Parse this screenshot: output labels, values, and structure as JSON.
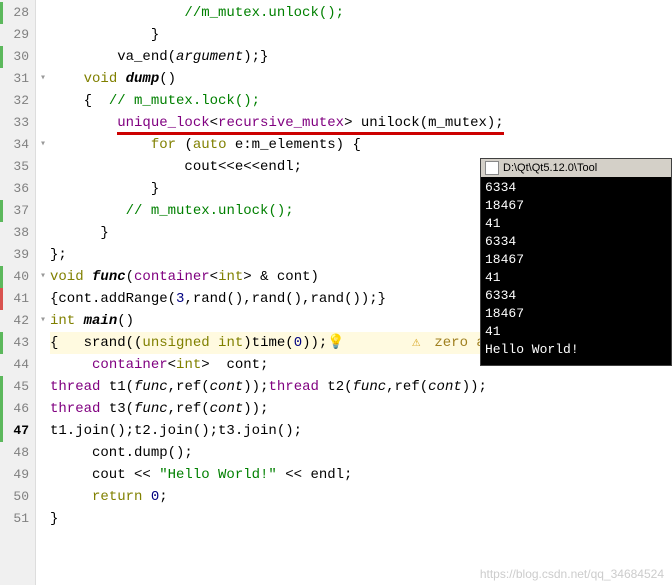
{
  "lines": [
    {
      "n": "28",
      "mark": "green",
      "fold": "",
      "code": "                //m_mutex.unlock();",
      "cls": [
        "comment"
      ]
    },
    {
      "n": "29",
      "mark": "",
      "fold": "",
      "code": "            }"
    },
    {
      "n": "30",
      "mark": "green",
      "fold": "",
      "code": "        va_end(argument);}",
      "parts": [
        {
          "t": "        va_end(",
          "c": ""
        },
        {
          "t": "argument",
          "c": "param"
        },
        {
          "t": ");}",
          "c": ""
        }
      ]
    },
    {
      "n": "31",
      "mark": "",
      "fold": "▾",
      "code": "    void dump()",
      "parts": [
        {
          "t": "    ",
          "c": ""
        },
        {
          "t": "void",
          "c": "kw"
        },
        {
          "t": " ",
          "c": ""
        },
        {
          "t": "dump",
          "c": "func"
        },
        {
          "t": "()",
          "c": ""
        }
      ]
    },
    {
      "n": "32",
      "mark": "",
      "fold": "",
      "code": "    {  // m_mutex.lock();",
      "parts": [
        {
          "t": "    {  ",
          "c": ""
        },
        {
          "t": "// m_mutex.lock();",
          "c": "comment"
        }
      ]
    },
    {
      "n": "33",
      "mark": "",
      "fold": "",
      "code": "        unique_lock<recursive_mutex> unilock(m_mutex);",
      "ul": true,
      "parts": [
        {
          "t": "        ",
          "c": ""
        },
        {
          "t": "unique_lock",
          "c": "type"
        },
        {
          "t": "<",
          "c": ""
        },
        {
          "t": "recursive_mutex",
          "c": "type"
        },
        {
          "t": "> unilock(m_mutex);",
          "c": ""
        }
      ]
    },
    {
      "n": "34",
      "mark": "",
      "fold": "▾",
      "code": "            for (auto e:m_elements) {",
      "parts": [
        {
          "t": "            ",
          "c": ""
        },
        {
          "t": "for",
          "c": "kw"
        },
        {
          "t": " (",
          "c": ""
        },
        {
          "t": "auto",
          "c": "kw"
        },
        {
          "t": " e:m_elements) {",
          "c": ""
        }
      ]
    },
    {
      "n": "35",
      "mark": "",
      "fold": "",
      "code": "                cout<<e<<endl;"
    },
    {
      "n": "36",
      "mark": "",
      "fold": "",
      "code": "            }"
    },
    {
      "n": "37",
      "mark": "green",
      "fold": "",
      "code": "         // m_mutex.unlock();",
      "parts": [
        {
          "t": "         ",
          "c": ""
        },
        {
          "t": "// m_mutex.unlock();",
          "c": "comment"
        }
      ]
    },
    {
      "n": "38",
      "mark": "",
      "fold": "",
      "code": "      }"
    },
    {
      "n": "39",
      "mark": "",
      "fold": "",
      "code": "};"
    },
    {
      "n": "40",
      "mark": "green",
      "fold": "▾",
      "code": "void func(container<int> & cont)",
      "parts": [
        {
          "t": "",
          "c": ""
        },
        {
          "t": "void",
          "c": "kw"
        },
        {
          "t": " ",
          "c": ""
        },
        {
          "t": "func",
          "c": "func"
        },
        {
          "t": "(",
          "c": ""
        },
        {
          "t": "container",
          "c": "type"
        },
        {
          "t": "<",
          "c": ""
        },
        {
          "t": "int",
          "c": "kw"
        },
        {
          "t": "> & cont)",
          "c": ""
        }
      ]
    },
    {
      "n": "41",
      "mark": "red",
      "fold": "",
      "code": "{cont.addRange(3,rand(),rand(),rand());}",
      "parts": [
        {
          "t": "{cont.addRange(",
          "c": ""
        },
        {
          "t": "3",
          "c": "num"
        },
        {
          "t": ",rand(),rand(),rand());}",
          "c": ""
        }
      ]
    },
    {
      "n": "42",
      "mark": "",
      "fold": "▾",
      "code": "int main()",
      "parts": [
        {
          "t": "",
          "c": ""
        },
        {
          "t": "int",
          "c": "kw"
        },
        {
          "t": " ",
          "c": ""
        },
        {
          "t": "main",
          "c": "func"
        },
        {
          "t": "()",
          "c": ""
        }
      ]
    },
    {
      "n": "43",
      "mark": "green",
      "fold": "",
      "hl": true,
      "warn": true,
      "code": "{   srand((unsigned int)time(0));",
      "parts": [
        {
          "t": "{   srand((",
          "c": ""
        },
        {
          "t": "unsigned",
          "c": "kw"
        },
        {
          "t": " ",
          "c": ""
        },
        {
          "t": "int",
          "c": "kw"
        },
        {
          "t": ")time(",
          "c": ""
        },
        {
          "t": "0",
          "c": "num"
        },
        {
          "t": "));",
          "c": ""
        }
      ],
      "warntext": "zero as null p"
    },
    {
      "n": "44",
      "mark": "",
      "fold": "",
      "code": "     container<int>  cont;",
      "parts": [
        {
          "t": "     ",
          "c": ""
        },
        {
          "t": "container",
          "c": "type"
        },
        {
          "t": "<",
          "c": ""
        },
        {
          "t": "int",
          "c": "kw"
        },
        {
          "t": ">  cont;",
          "c": ""
        }
      ]
    },
    {
      "n": "45",
      "mark": "green",
      "fold": "",
      "code": "thread t1(func,ref(cont));thread t2(func,ref(cont));",
      "parts": [
        {
          "t": "",
          "c": ""
        },
        {
          "t": "thread",
          "c": "type"
        },
        {
          "t": " t1(",
          "c": ""
        },
        {
          "t": "func",
          "c": "param"
        },
        {
          "t": ",ref(",
          "c": ""
        },
        {
          "t": "cont",
          "c": "param"
        },
        {
          "t": "));",
          "c": ""
        },
        {
          "t": "thread",
          "c": "type"
        },
        {
          "t": " t2(",
          "c": ""
        },
        {
          "t": "func",
          "c": "param"
        },
        {
          "t": ",ref(",
          "c": ""
        },
        {
          "t": "cont",
          "c": "param"
        },
        {
          "t": "));",
          "c": ""
        }
      ]
    },
    {
      "n": "46",
      "mark": "green",
      "fold": "",
      "code": "thread t3(func,ref(cont));",
      "parts": [
        {
          "t": "",
          "c": ""
        },
        {
          "t": "thread",
          "c": "type"
        },
        {
          "t": " t3(",
          "c": ""
        },
        {
          "t": "func",
          "c": "param"
        },
        {
          "t": ",ref(",
          "c": ""
        },
        {
          "t": "cont",
          "c": "param"
        },
        {
          "t": "));",
          "c": ""
        }
      ]
    },
    {
      "n": "47",
      "mark": "green",
      "fold": "",
      "current": true,
      "code": "t1.join();t2.join();t3.join();",
      "parts": [
        {
          "t": "t1.join();t2.join();t3.join();",
          "c": ""
        }
      ]
    },
    {
      "n": "48",
      "mark": "",
      "fold": "",
      "code": "     cont.dump();"
    },
    {
      "n": "49",
      "mark": "",
      "fold": "",
      "code": "     cout << \"Hello World!\" << endl;",
      "parts": [
        {
          "t": "     cout << ",
          "c": ""
        },
        {
          "t": "\"Hello World!\"",
          "c": "str"
        },
        {
          "t": " << endl;",
          "c": ""
        }
      ]
    },
    {
      "n": "50",
      "mark": "",
      "fold": "",
      "code": "     return 0;",
      "parts": [
        {
          "t": "     ",
          "c": ""
        },
        {
          "t": "return",
          "c": "kw"
        },
        {
          "t": " ",
          "c": ""
        },
        {
          "t": "0",
          "c": "num"
        },
        {
          "t": ";",
          "c": ""
        }
      ]
    },
    {
      "n": "51",
      "mark": "",
      "fold": "",
      "code": "}"
    }
  ],
  "console": {
    "title": "D:\\Qt\\Qt5.12.0\\Tool",
    "output": [
      "6334",
      "18467",
      "41",
      "6334",
      "18467",
      "41",
      "6334",
      "18467",
      "41",
      "Hello World!"
    ]
  },
  "watermark": "https://blog.csdn.net/qq_34684524"
}
